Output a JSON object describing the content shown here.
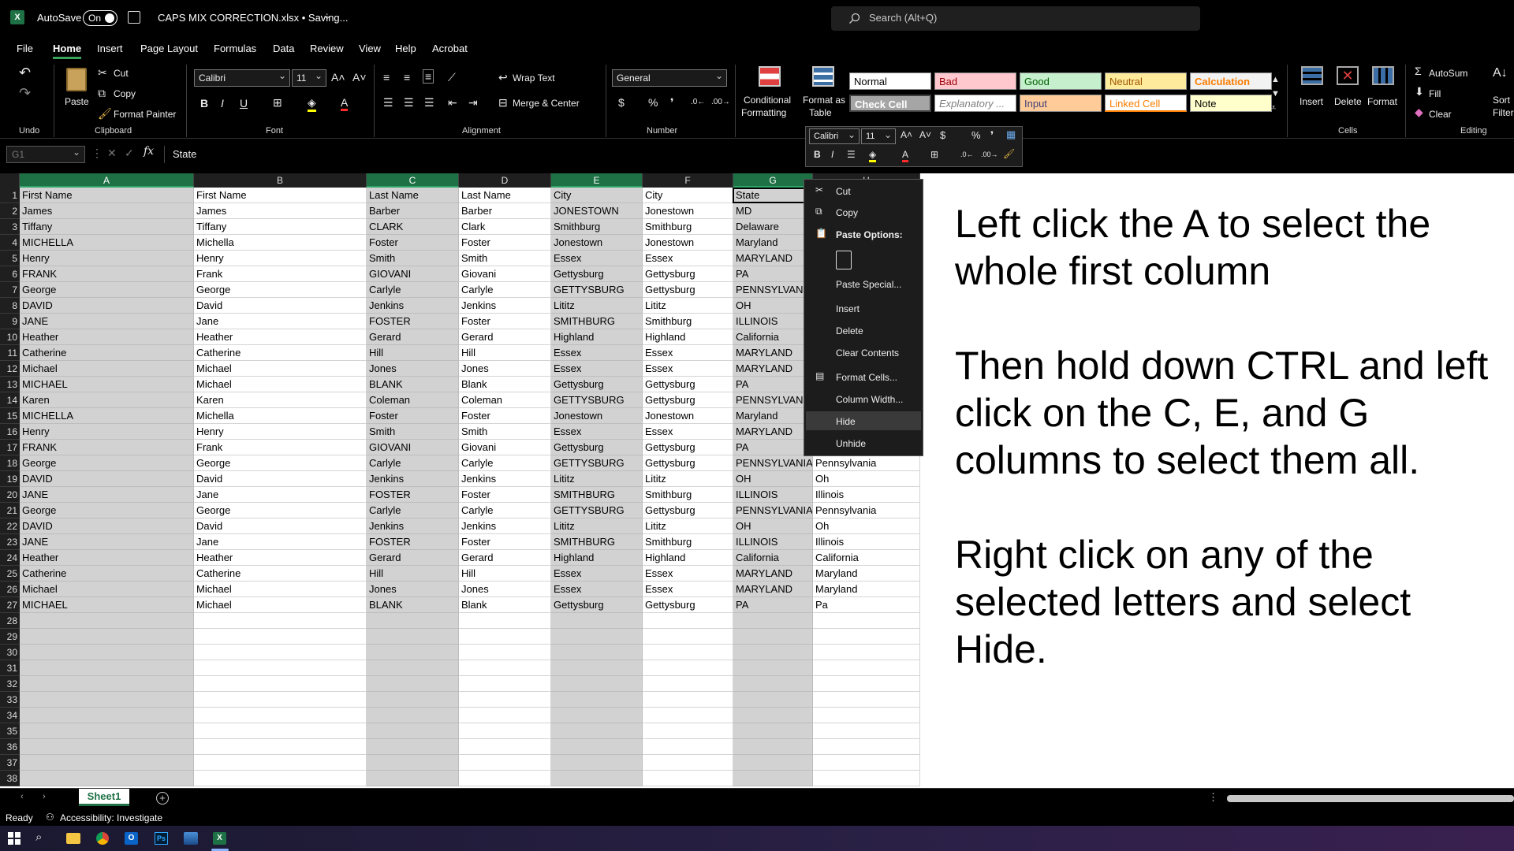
{
  "title_bar": {
    "autosave_label": "AutoSave",
    "toggle_state": "On",
    "file_title": "CAPS MIX CORRECTION.xlsx • Saving...",
    "search_placeholder": "Search (Alt+Q)"
  },
  "tabs": [
    "File",
    "Home",
    "Insert",
    "Page Layout",
    "Formulas",
    "Data",
    "Review",
    "View",
    "Help",
    "Acrobat"
  ],
  "active_tab": "Home",
  "ribbon": {
    "groups": {
      "undo": "Undo",
      "clipboard": "Clipboard",
      "font": "Font",
      "alignment": "Alignment",
      "number": "Number",
      "cells": "Cells",
      "editing": "Editing"
    },
    "paste": "Paste",
    "cut": "Cut",
    "copy": "Copy",
    "format_painter": "Format Painter",
    "font_name": "Calibri",
    "font_size": "11",
    "wrap_text": "Wrap Text",
    "merge_center": "Merge & Center",
    "number_format": "General",
    "conditional_1": "Conditional",
    "conditional_2": "Formatting",
    "format_as_1": "Format as",
    "format_as_2": "Table",
    "styles": [
      {
        "label": "Normal",
        "bg": "#ffffff",
        "fg": "#000000"
      },
      {
        "label": "Bad",
        "bg": "#ffc7ce",
        "fg": "#9c0006"
      },
      {
        "label": "Good",
        "bg": "#c6efce",
        "fg": "#006100"
      },
      {
        "label": "Neutral",
        "bg": "#ffeb9c",
        "fg": "#9c5700"
      },
      {
        "label": "Calculation",
        "bg": "#f2f2f2",
        "fg": "#fa7d00"
      },
      {
        "label": "Check Cell",
        "bg": "#a5a5a5",
        "fg": "#ffffff"
      },
      {
        "label": "Explanatory ...",
        "bg": "#ffffff",
        "fg": "#7f7f7f"
      },
      {
        "label": "Input",
        "bg": "#ffcc99",
        "fg": "#3f3f76"
      },
      {
        "label": "Linked Cell",
        "bg": "#ffffff",
        "fg": "#fa7d00"
      },
      {
        "label": "Note",
        "bg": "#ffffcc",
        "fg": "#000000"
      }
    ],
    "insert": "Insert",
    "delete": "Delete",
    "format": "Format",
    "autosum": "AutoSum",
    "fill": "Fill",
    "clear": "Clear",
    "sort": "Sort",
    "filter": "Filter"
  },
  "formula_bar": {
    "name_box": "G1",
    "content": "State"
  },
  "columns": [
    "A",
    "B",
    "C",
    "D",
    "E",
    "F",
    "G",
    "H"
  ],
  "rows": [
    [
      "First Name",
      "First Name",
      "Last Name",
      "Last Name",
      "City",
      "City",
      "State",
      ""
    ],
    [
      "James",
      "James",
      "Barber",
      "Barber",
      "JONESTOWN",
      "Jonestown",
      "MD",
      ""
    ],
    [
      "Tiffany",
      "Tiffany",
      "CLARK",
      "Clark",
      "Smithburg",
      "Smithburg",
      "Delaware",
      ""
    ],
    [
      "MICHELLA",
      "Michella",
      "Foster",
      "Foster",
      "Jonestown",
      "Jonestown",
      "Maryland",
      ""
    ],
    [
      "Henry",
      "Henry",
      "Smith",
      "Smith",
      "Essex",
      "Essex",
      "MARYLAND",
      ""
    ],
    [
      "FRANK",
      "Frank",
      "GIOVANI",
      "Giovani",
      "Gettysburg",
      "Gettysburg",
      "PA",
      ""
    ],
    [
      "George",
      "George",
      "Carlyle",
      "Carlyle",
      "GETTYSBURG",
      "Gettysburg",
      "PENNSYLVANI",
      ""
    ],
    [
      "DAVID",
      "David",
      "Jenkins",
      "Jenkins",
      "Lititz",
      "Lititz",
      "OH",
      ""
    ],
    [
      "JANE",
      "Jane",
      "FOSTER",
      "Foster",
      "SMITHBURG",
      "Smithburg",
      "ILLINOIS",
      ""
    ],
    [
      "Heather",
      "Heather",
      "Gerard",
      "Gerard",
      "Highland",
      "Highland",
      "California",
      ""
    ],
    [
      "Catherine",
      "Catherine",
      "Hill",
      "Hill",
      "Essex",
      "Essex",
      "MARYLAND",
      ""
    ],
    [
      "Michael",
      "Michael",
      "Jones",
      "Jones",
      "Essex",
      "Essex",
      "MARYLAND",
      ""
    ],
    [
      "MICHAEL",
      "Michael",
      "BLANK",
      "Blank",
      "Gettysburg",
      "Gettysburg",
      "PA",
      ""
    ],
    [
      "Karen",
      "Karen",
      "Coleman",
      "Coleman",
      "GETTYSBURG",
      "Gettysburg",
      "PENNSYLVANI",
      ""
    ],
    [
      "MICHELLA",
      "Michella",
      "Foster",
      "Foster",
      "Jonestown",
      "Jonestown",
      "Maryland",
      ""
    ],
    [
      "Henry",
      "Henry",
      "Smith",
      "Smith",
      "Essex",
      "Essex",
      "MARYLAND",
      ""
    ],
    [
      "FRANK",
      "Frank",
      "GIOVANI",
      "Giovani",
      "Gettysburg",
      "Gettysburg",
      "PA",
      ""
    ],
    [
      "George",
      "George",
      "Carlyle",
      "Carlyle",
      "GETTYSBURG",
      "Gettysburg",
      "PENNSYLVANIA",
      "Pennsylvania"
    ],
    [
      "DAVID",
      "David",
      "Jenkins",
      "Jenkins",
      "Lititz",
      "Lititz",
      "OH",
      "Oh"
    ],
    [
      "JANE",
      "Jane",
      "FOSTER",
      "Foster",
      "SMITHBURG",
      "Smithburg",
      "ILLINOIS",
      "Illinois"
    ],
    [
      "George",
      "George",
      "Carlyle",
      "Carlyle",
      "GETTYSBURG",
      "Gettysburg",
      "PENNSYLVANIA",
      "Pennsylvania"
    ],
    [
      "DAVID",
      "David",
      "Jenkins",
      "Jenkins",
      "Lititz",
      "Lititz",
      "OH",
      "Oh"
    ],
    [
      "JANE",
      "Jane",
      "FOSTER",
      "Foster",
      "SMITHBURG",
      "Smithburg",
      "ILLINOIS",
      "Illinois"
    ],
    [
      "Heather",
      "Heather",
      "Gerard",
      "Gerard",
      "Highland",
      "Highland",
      "California",
      "California"
    ],
    [
      "Catherine",
      "Catherine",
      "Hill",
      "Hill",
      "Essex",
      "Essex",
      "MARYLAND",
      "Maryland"
    ],
    [
      "Michael",
      "Michael",
      "Jones",
      "Jones",
      "Essex",
      "Essex",
      "MARYLAND",
      "Maryland"
    ],
    [
      "MICHAEL",
      "Michael",
      "BLANK",
      "Blank",
      "Gettysburg",
      "Gettysburg",
      "PA",
      "Pa"
    ],
    [
      "",
      "",
      "",
      "",
      "",
      "",
      "",
      ""
    ],
    [
      "",
      "",
      "",
      "",
      "",
      "",
      "",
      ""
    ],
    [
      "",
      "",
      "",
      "",
      "",
      "",
      "",
      ""
    ],
    [
      "",
      "",
      "",
      "",
      "",
      "",
      "",
      ""
    ],
    [
      "",
      "",
      "",
      "",
      "",
      "",
      "",
      ""
    ],
    [
      "",
      "",
      "",
      "",
      "",
      "",
      "",
      ""
    ],
    [
      "",
      "",
      "",
      "",
      "",
      "",
      "",
      ""
    ],
    [
      "",
      "",
      "",
      "",
      "",
      "",
      "",
      ""
    ],
    [
      "",
      "",
      "",
      "",
      "",
      "",
      "",
      ""
    ],
    [
      "",
      "",
      "",
      "",
      "",
      "",
      "",
      ""
    ],
    [
      "",
      "",
      "",
      "",
      "",
      "",
      "",
      ""
    ]
  ],
  "mini_toolbar": {
    "font_name": "Calibri",
    "font_size": "11"
  },
  "context_menu": {
    "items": [
      "Cut",
      "Copy",
      "Paste Options:",
      "Paste Special...",
      "Insert",
      "Delete",
      "Clear Contents",
      "Format Cells...",
      "Column Width...",
      "Hide",
      "Unhide"
    ],
    "highlighted": "Hide"
  },
  "instructions": [
    "Left click the A to select the whole first column",
    "Then hold down CTRL and left click on the C, E, and G columns to select them all.",
    "Right click on any of the selected letters and select Hide."
  ],
  "sheet_tab": "Sheet1",
  "status": {
    "ready": "Ready",
    "accessibility": "Accessibility: Investigate"
  },
  "colors": {
    "excel_green": "#1e7145",
    "selected_gray": "#d2d2d2",
    "accent": "#3aa35c"
  }
}
